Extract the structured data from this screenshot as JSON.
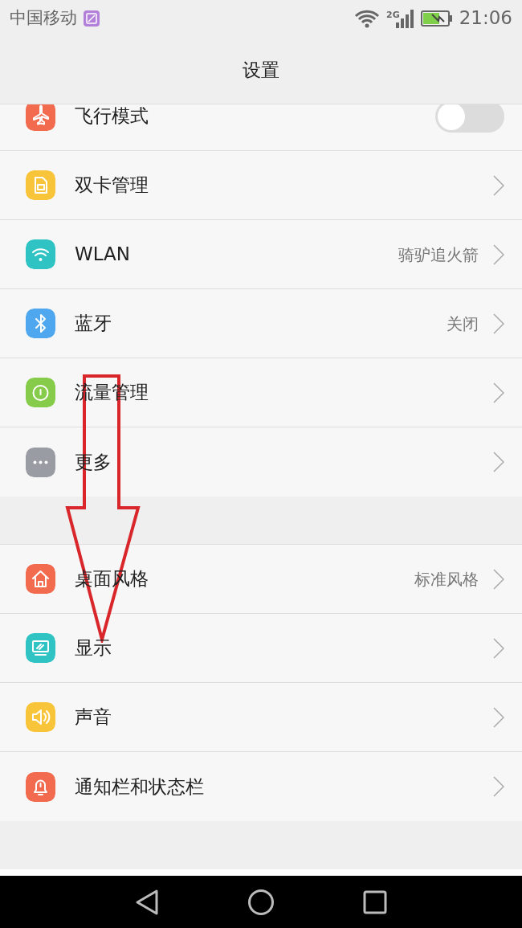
{
  "status_bar": {
    "carrier": "中国移动",
    "network": "2G",
    "time": "21:06"
  },
  "title": "设置",
  "groups": [
    {
      "items": [
        {
          "kind": "toggle",
          "label": "飞行模式",
          "color": "#f26b4f",
          "on": false
        },
        {
          "kind": "link",
          "label": "双卡管理",
          "color": "#f8c43a"
        },
        {
          "kind": "link",
          "label": "WLAN",
          "value": "骑驴追火箭",
          "color": "#2fc3c3"
        },
        {
          "kind": "link",
          "label": "蓝牙",
          "value": "关闭",
          "color": "#4fa8ef"
        },
        {
          "kind": "link",
          "label": "流量管理",
          "color": "#86cc4a"
        },
        {
          "kind": "link",
          "label": "更多",
          "color": "#9a9ca3"
        }
      ]
    },
    {
      "items": [
        {
          "kind": "link",
          "label": "桌面风格",
          "value": "标准风格",
          "color": "#f26b4f"
        },
        {
          "kind": "link",
          "label": "显示",
          "color": "#2fc3c3"
        },
        {
          "kind": "link",
          "label": "声音",
          "color": "#f8c43a"
        },
        {
          "kind": "link",
          "label": "通知栏和状态栏",
          "color": "#f26b4f"
        }
      ]
    }
  ]
}
